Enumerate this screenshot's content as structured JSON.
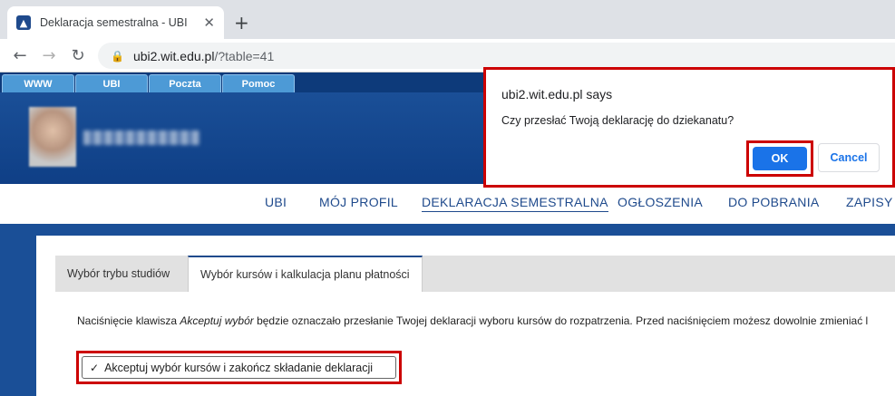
{
  "browser": {
    "tab_title": "Deklaracja semestralna - UBI",
    "tab_close": "✕",
    "new_tab": "+",
    "url_host": "ubi2.wit.edu.pl",
    "url_path": "/?table=41"
  },
  "topnav": {
    "items": [
      "WWW",
      "UBI",
      "Poczta",
      "Pomoc"
    ]
  },
  "profile": {
    "name": "●●●●●●●●●●"
  },
  "mainnav": {
    "items": [
      "UBI",
      "MÓJ PROFIL",
      "DEKLARACJA SEMESTRALNA",
      "OGŁOSZENIA",
      "DO POBRANIA",
      "ZAPISY G"
    ],
    "active": "DEKLARACJA SEMESTRALNA"
  },
  "content": {
    "tabs": [
      "Wybór trybu studiów",
      "Wybór kursów i kalkulacja planu płatności"
    ],
    "notice_before": "Naciśnięcie klawisza ",
    "notice_em": "Akceptuj wybór",
    "notice_after": " będzie oznaczało przesłanie Twojej deklaracji wyboru kursów do rozpatrzenia. Przed naciśnięciem możesz dowolnie zmieniać l",
    "accept_button": "Akceptuj wybór kursów i zakończ składanie deklaracji"
  },
  "dialog": {
    "title": "ubi2.wit.edu.pl says",
    "message": "Czy przesłać Twoją deklarację do dziekanatu?",
    "ok": "OK",
    "cancel": "Cancel"
  },
  "colors": {
    "accent": "#1a73e8",
    "brand": "#1f4a8c",
    "highlight": "#cc0000"
  }
}
